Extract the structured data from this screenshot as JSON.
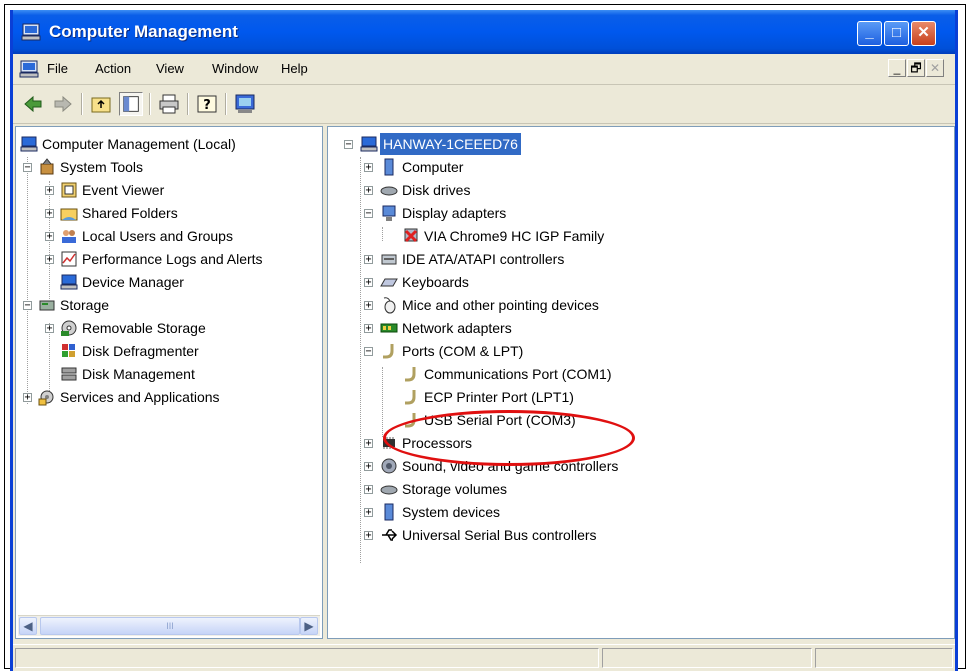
{
  "window": {
    "title": "Computer Management",
    "controls": {
      "minimize": "_",
      "maximize": "□",
      "close": "✕"
    }
  },
  "menu": {
    "items": [
      "File",
      "Action",
      "View",
      "Window",
      "Help"
    ],
    "mdi_controls": [
      "_",
      "🗗",
      "✕"
    ]
  },
  "toolbar": {
    "buttons": [
      "back-arrow-icon",
      "forward-arrow-icon",
      "up-folder-icon",
      "show-hide-tree-icon",
      "print-icon",
      "help-icon",
      "console-icon"
    ]
  },
  "left_tree": {
    "root": "Computer Management (Local)",
    "system_tools": "System Tools",
    "event_viewer": "Event Viewer",
    "shared_folders": "Shared Folders",
    "local_users": "Local Users and Groups",
    "perf_logs": "Performance Logs and Alerts",
    "device_manager": "Device Manager",
    "storage": "Storage",
    "removable_storage": "Removable Storage",
    "disk_defrag": "Disk Defragmenter",
    "disk_mgmt": "Disk Management",
    "services_apps": "Services and Applications",
    "scroll_grip": "III"
  },
  "device_tree": {
    "root": "HANWAY-1CEEED76",
    "computer": "Computer",
    "disk_drives": "Disk drives",
    "display_adapters": "Display adapters",
    "via_chrome": "VIA Chrome9 HC IGP Family",
    "ide": "IDE ATA/ATAPI controllers",
    "keyboards": "Keyboards",
    "mice": "Mice and other pointing devices",
    "network": "Network adapters",
    "ports": "Ports (COM & LPT)",
    "com1": "Communications Port (COM1)",
    "lpt1": "ECP Printer Port (LPT1)",
    "com3": "USB Serial Port (COM3)",
    "processors": "Processors",
    "sound": "Sound, video and game controllers",
    "storage_volumes": "Storage volumes",
    "system_devices": "System devices",
    "usb": "Universal Serial Bus controllers"
  },
  "colors": {
    "titlebar": "#0058ee",
    "selection": "#316ac5",
    "annotation": "#e01010"
  }
}
